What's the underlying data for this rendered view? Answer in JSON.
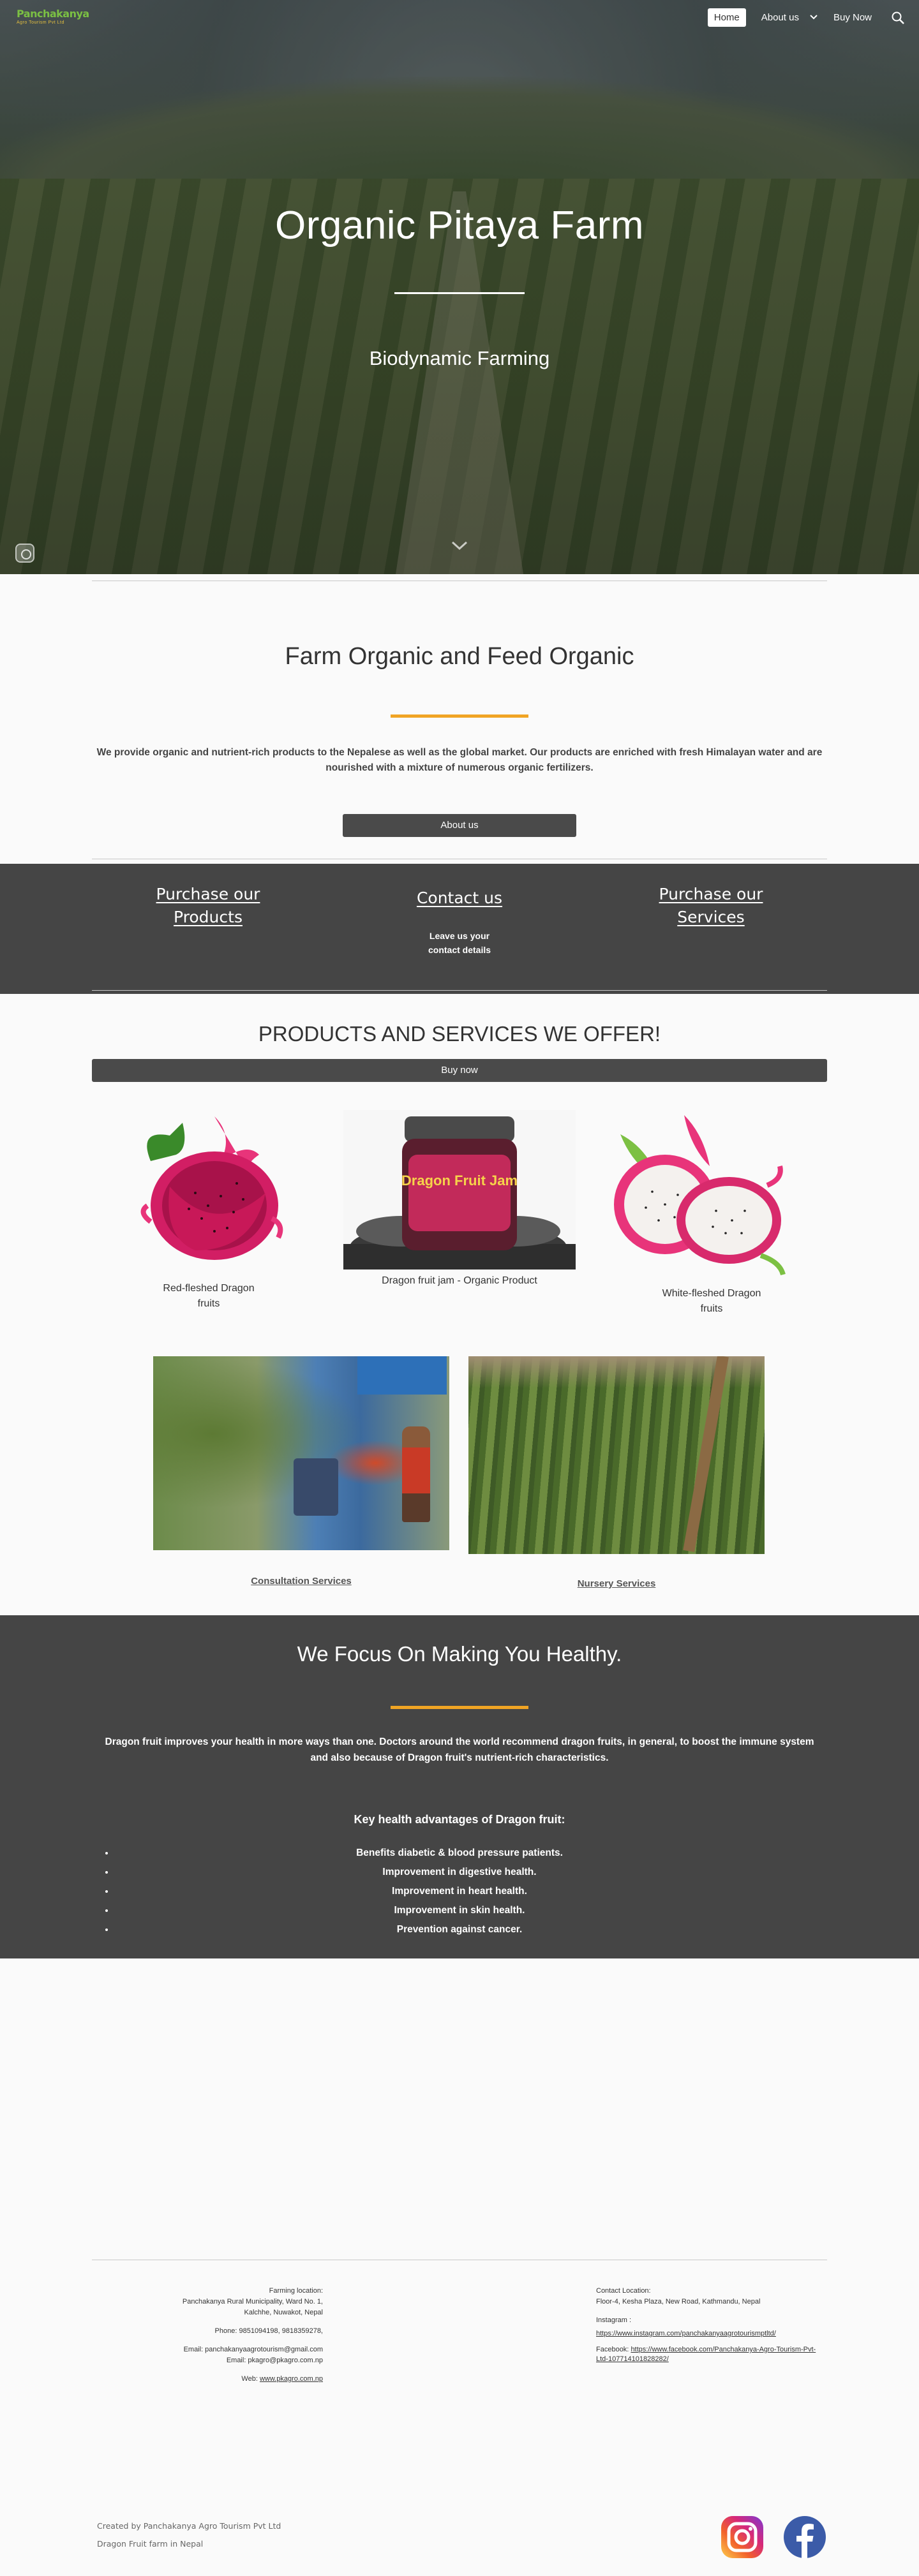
{
  "header": {
    "logo_line1": "Panchakanya",
    "logo_line2": "Agro Tourism Pvt Ltd",
    "nav": {
      "home": "Home",
      "about": "About us",
      "buy": "Buy Now"
    }
  },
  "hero": {
    "title": "Organic Pitaya Farm",
    "subtitle": "Biodynamic Farming"
  },
  "intro": {
    "title": "Farm Organic and Feed Organic",
    "text": "We provide organic and nutrient-rich products to the Nepalese as well as the global market. Our products are enriched with fresh Himalayan water and are nourished with a mixture of numerous organic fertilizers.",
    "button": "About us"
  },
  "band": {
    "link_left_1": "Purchase our",
    "link_left_2": "Products",
    "link_center": "Contact us",
    "note_1": "Leave us your",
    "note_2": "contact details",
    "link_right_1": "Purchase our",
    "link_right_2": "Services"
  },
  "products": {
    "title": "PRODUCTS AND SERVICES WE OFFER!",
    "buy_button": "Buy now",
    "jar_label": "Dragon Fruit Jam",
    "items": [
      {
        "line1": "Red-fleshed Dragon",
        "line2": "fruits"
      },
      {
        "line1": "Dragon fruit jam - Organic Product",
        "line2": ""
      },
      {
        "line1": "White-fleshed Dragon",
        "line2": "fruits"
      }
    ],
    "services": [
      "Consultation Services",
      "Nursery Services"
    ]
  },
  "health": {
    "title": "We Focus On Making You Healthy.",
    "text": "Dragon fruit improves your health in more ways than one. Doctors around the world recommend dragon fruits, in general, to boost the immune system and also because of Dragon fruit's nutrient-rich characteristics.",
    "subtitle": "Key health advantages of Dragon fruit:",
    "list": [
      "Benefits diabetic & blood pressure patients.",
      "Improvement in digestive health.",
      "Improvement in heart health.",
      "Improvement in skin health.",
      "Prevention against cancer."
    ]
  },
  "footer": {
    "farm": {
      "label": "Farming location:",
      "addr1": "Panchakanya Rural Municipality, Ward No. 1,",
      "addr2": "Kalchhe, Nuwakot, Nepal",
      "phone": "Phone: 9851094198, 9818359278,",
      "email1": "Email:  panchakanyaagrotourism@gmail.com",
      "email2": "Email: pkagro@pkagro.com.np",
      "web_label": "Web:",
      "web": "www.pkagro.com.np"
    },
    "contact": {
      "label": "Contact Location:",
      "addr": "Floor-4, Kesha Plaza, New Road, Kathmandu, Nepal",
      "instagram_label": "Instagram :",
      "instagram": "https://www.instagram.com/panchakanyaagrotourismptltd/",
      "facebook_label": "Facebook:",
      "facebook": "https://www.facebook.com/Panchakanya-Agro-Tourism-Pvt-Ltd-107714101828282/"
    },
    "credit1": "Created by Panchakanya Agro Tourism Pvt Ltd",
    "credit2": "Dragon Fruit farm in Nepal"
  },
  "colors": {
    "accent_orange": "#f0a424",
    "band_gray": "#454545",
    "logo_green": "#7bc043",
    "logo_yellow": "#e7c13e"
  },
  "icons": {
    "search": "search-icon",
    "chevron": "chevron-down-icon",
    "instagram": "instagram-icon",
    "facebook": "facebook-icon"
  }
}
